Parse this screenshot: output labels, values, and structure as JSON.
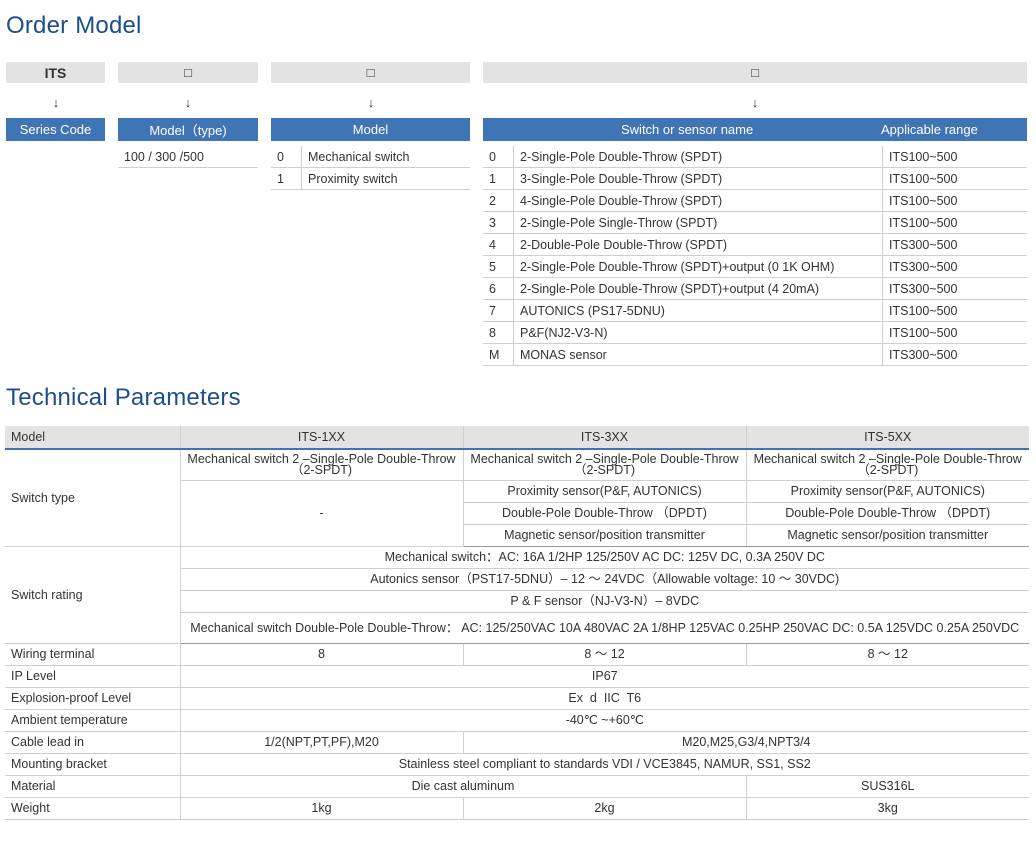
{
  "order_model": {
    "title": "Order Model",
    "header_boxes": [
      "ITS",
      "□",
      "□",
      "□"
    ],
    "arrow": "↓",
    "blue_labels": {
      "series_code": "Series Code",
      "model_type": "Model（type)",
      "model": "Model",
      "switch_name": "Switch or sensor name",
      "applicable_range": "Applicable range"
    },
    "model_type_value": "100 / 300 /500",
    "model_rows": [
      {
        "code": "0",
        "name": "Mechanical switch"
      },
      {
        "code": "1",
        "name": "Proximity switch"
      }
    ],
    "switch_rows": [
      {
        "code": "0",
        "name": "2-Single-Pole Double-Throw (SPDT)",
        "range": "ITS100~500"
      },
      {
        "code": "1",
        "name": "3-Single-Pole Double-Throw (SPDT)",
        "range": "ITS100~500"
      },
      {
        "code": "2",
        "name": "4-Single-Pole Double-Throw (SPDT)",
        "range": "ITS100~500"
      },
      {
        "code": "3",
        "name": "2-Single-Pole Single-Throw (SPDT)",
        "range": "ITS100~500"
      },
      {
        "code": "4",
        "name": "2-Double-Pole Double-Throw (SPDT)",
        "range": "ITS300~500"
      },
      {
        "code": "5",
        "name": "2-Single-Pole Double-Throw (SPDT)+output (0 1K OHM)",
        "range": "ITS300~500"
      },
      {
        "code": "6",
        "name": "2-Single-Pole Double-Throw (SPDT)+output (4 20mA)",
        "range": "ITS300~500"
      },
      {
        "code": "7",
        "name": "AUTONICS (PS17-5DNU)",
        "range": "ITS100~500"
      },
      {
        "code": "8",
        "name": "P&F(NJ2-V3-N)",
        "range": "ITS100~500"
      },
      {
        "code": "M",
        "name": "MONAS sensor",
        "range": "ITS300~500"
      }
    ]
  },
  "tech": {
    "title": "Technical Parameters",
    "headers": [
      "Model",
      "ITS-1XX",
      "ITS-3XX",
      "ITS-5XX"
    ],
    "switch_type": {
      "label": "Switch  type",
      "mech": "Mechanical switch 2 –Single-Pole Double-Throw（2-SPDT)",
      "dash": "-",
      "proximity": "Proximity sensor(P&F, AUTONICS)",
      "dpdt": "Double-Pole Double-Throw （DPDT)",
      "magnetic": "Magnetic sensor/position transmitter"
    },
    "switch_rating": {
      "label": "Switch rating",
      "lines": [
        "Mechanical switch：AC: 16A 1/2HP 125/250V AC    DC: 125V DC, 0.3A 250V DC",
        "Autonics sensor（PST17-5DNU）– 12 ～ 24VDC（Allowable voltage: 10 ～ 30VDC)",
        "P & F sensor（NJ-V3-N）– 8VDC",
        "Mechanical switch Double-Pole Double-Throw：  AC: 125/250VAC 10A 480VAC 2A 1/8HP 125VAC 0.25HP 250VAC   DC: 0.5A 125VDC 0.25A 250VDC"
      ]
    },
    "wiring": {
      "label": "Wiring terminal",
      "v1": "8",
      "v3": "8 ～ 12",
      "v5": "8 ～ 12"
    },
    "ip": {
      "label": "IP Level",
      "v": "IP67"
    },
    "explosion": {
      "label": "Explosion-proof Level",
      "v": "Ex  d  IIC  T6"
    },
    "ambient": {
      "label": "Ambient temperature",
      "v": "-40℃ ~+60℃"
    },
    "cable": {
      "label": "Cable lead in",
      "v1": "1/2(NPT,PT,PF),M20",
      "v35": "M20,M25,G3/4,NPT3/4"
    },
    "bracket": {
      "label": "Mounting bracket",
      "v": "Stainless steel compliant to standards VDI / VCE3845,  NAMUR,  SS1,  SS2"
    },
    "material": {
      "label": "Material",
      "v13": "Die cast aluminum",
      "v5": "SUS316L"
    },
    "weight": {
      "label": "Weight",
      "v1": "1kg",
      "v3": "2kg",
      "v5": "3kg"
    }
  }
}
